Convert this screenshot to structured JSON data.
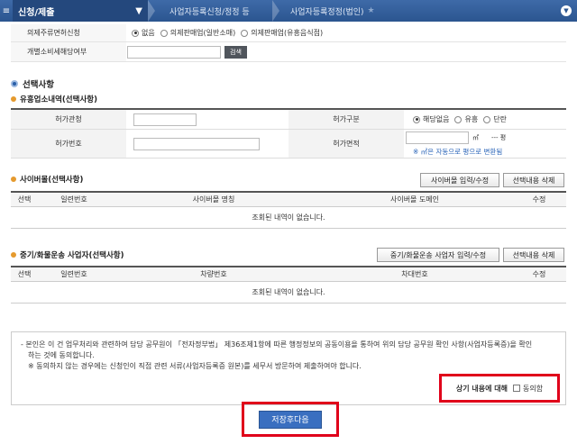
{
  "header": {
    "menu": "신청/제출",
    "crumb2": "사업자등록신청/정정 등",
    "crumb3": "사업자등록정정(법인)"
  },
  "liquor": {
    "label": "의제주류면허신청",
    "options": [
      "없음",
      "의제판매업(일반소매)",
      "의제판매업(유흥음식점)"
    ],
    "selected": "없음"
  },
  "excise": {
    "label": "개별소비세해당여부",
    "search_btn": "검색"
  },
  "selection": {
    "title": "선택사항",
    "entertainment": {
      "title": "유흥업소내역(선택사항)",
      "permit_office_label": "허가관청",
      "permit_type_label": "허가구분",
      "permit_type_options": [
        "해당없음",
        "유흥",
        "단란"
      ],
      "permit_type_selected": "해당없음",
      "permit_no_label": "허가번호",
      "permit_area_label": "허가면적",
      "area_unit_m2": "㎡",
      "area_unit_pyeong": "--- 평",
      "area_note": "※ ㎡은 자동으로 평으로 변환됨"
    },
    "cybermall": {
      "title": "사이버몰(선택사항)",
      "input_btn": "사이버몰 입력/수정",
      "delete_btn": "선택내용 삭제",
      "columns": [
        "선택",
        "일련번호",
        "사이버몰 명칭",
        "사이버몰 도메인",
        "수정"
      ],
      "empty": "조회된 내역이 없습니다."
    },
    "freight": {
      "title": "중기/화물운송 사업자(선택사항)",
      "input_btn": "중기/화물운송 사업자 입력/수정",
      "delete_btn": "선택내용 삭제",
      "columns": [
        "선택",
        "일련번호",
        "차량번호",
        "차대번호",
        "수정"
      ],
      "empty": "조회된 내역이 없습니다."
    }
  },
  "consent": {
    "line1": "- 본인은 이 건 업무처리와 관련하여 담당 공무원이 「전자정부법」 제36조제1항에 따른 행정정보의 공동이용을 통하여 위의 담당 공무원 확인 사항(사업자등록증)을 확인",
    "line2": "하는 것에 동의합니다.",
    "line3": "※ 동의하지 않는 경우에는 신청인이 직접 관련 서류(사업자등록증 원본)를 세무서 방문하여 제출하여야 합니다.",
    "agree_label": "상기 내용에 대해",
    "agree_check": "동의함"
  },
  "save_btn": "저장후다음"
}
